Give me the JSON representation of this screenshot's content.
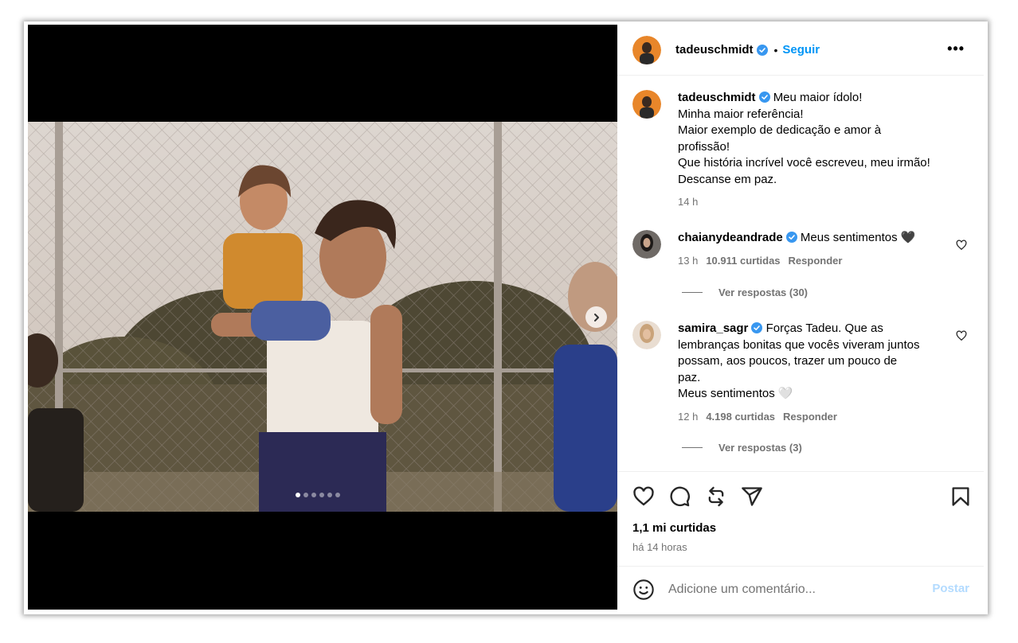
{
  "post": {
    "author": "tadeuschmidt",
    "follow_label": "Seguir",
    "separator": "•",
    "more_label": "•••",
    "caption_lines": [
      "Meu maior ídolo!",
      "Minha maior referência!",
      "Maior exemplo de dedicação e amor à",
      "profissão!",
      "Que história incrível você escreveu, meu irmão!",
      "Descanse em paz."
    ],
    "caption_time": "14 h",
    "carousel": {
      "slide_count": 6,
      "active_index": 0
    }
  },
  "comments": [
    {
      "user": "chaianydeandrade",
      "text": "Meus sentimentos 🖤",
      "time": "13 h",
      "likes": "10.911 curtidas",
      "reply_label": "Responder",
      "view_replies": "Ver respostas (30)"
    },
    {
      "user": "samira_sagr",
      "text_lines": [
        "Forças Tadeu. Que as",
        "lembranças bonitas que vocês viveram juntos",
        "possam, aos poucos, trazer um pouco de",
        "paz.",
        "Meus sentimentos 🤍"
      ],
      "time": "12 h",
      "likes": "4.198 curtidas",
      "reply_label": "Responder",
      "view_replies": "Ver respostas (3)"
    }
  ],
  "stats": {
    "likes": "1,1 mi curtidas",
    "time_ago": "há 14 horas"
  },
  "composer": {
    "placeholder": "Adicione um comentário...",
    "post_label": "Postar"
  },
  "colors": {
    "link_blue": "#0095f6",
    "post_disabled": "#b3dbff",
    "muted": "#737373",
    "verified_blue": "#3897f0"
  },
  "icons": [
    "heart-icon",
    "comment-icon",
    "repost-icon",
    "share-icon",
    "bookmark-icon",
    "emoji-icon",
    "verified-badge-icon",
    "chevron-right-icon"
  ]
}
